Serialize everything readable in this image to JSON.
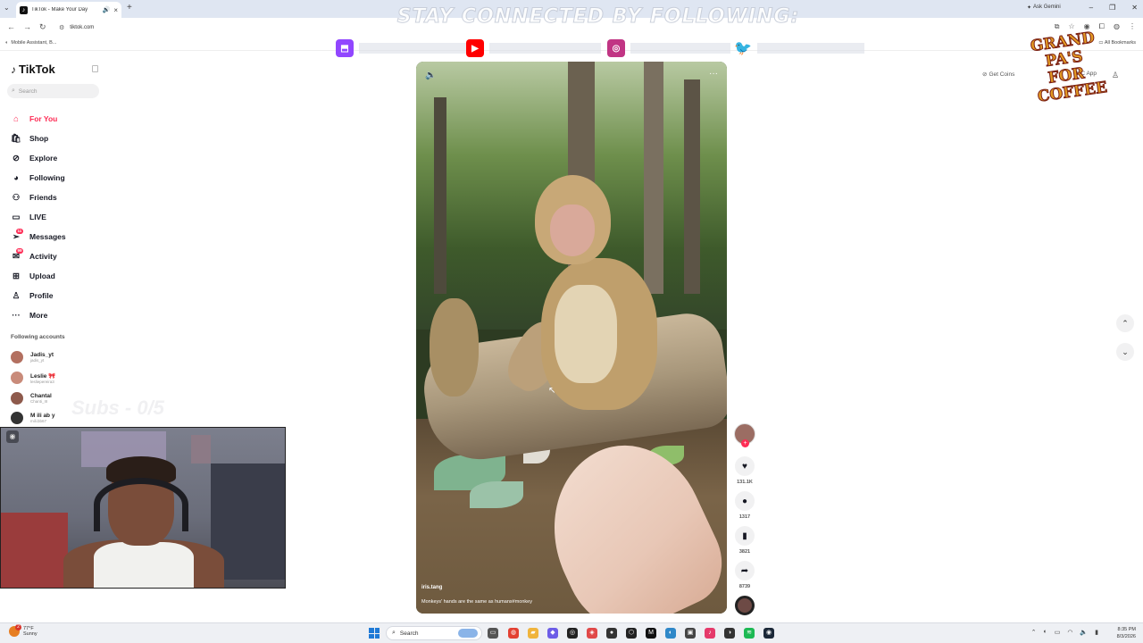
{
  "browser": {
    "tab_title": "TikTok - Make Your Day",
    "url": "tiktok.com",
    "bookmark_item": "Mobile Assistant, B...",
    "all_bookmarks": "All Bookmarks",
    "ask_gemini": "Ask Gemini"
  },
  "overlay": {
    "banner": "STAY CONNECTED BY FOLLOWING:",
    "logo_text": "GRANDPA'S FOR COFFEEE",
    "subs_ghost": "Subs - 0/5",
    "brand_colors": {
      "twitch": "#9146ff",
      "youtube": "#ff0000",
      "instagram": "#c13584",
      "twitter": "#1da1f2"
    }
  },
  "tiktok": {
    "logo": "TikTok",
    "search_placeholder": "Search",
    "accent_color": "#fe2c55",
    "nav": [
      {
        "label": "For You",
        "icon": "home-icon"
      },
      {
        "label": "Shop",
        "icon": "shop-icon"
      },
      {
        "label": "Explore",
        "icon": "compass-icon"
      },
      {
        "label": "Following",
        "icon": "following-icon"
      },
      {
        "label": "Friends",
        "icon": "friends-icon"
      },
      {
        "label": "LIVE",
        "icon": "live-icon"
      },
      {
        "label": "Messages",
        "icon": "messages-icon",
        "badge": "11"
      },
      {
        "label": "Activity",
        "icon": "activity-icon",
        "badge": "99"
      },
      {
        "label": "Upload",
        "icon": "upload-icon"
      },
      {
        "label": "Profile",
        "icon": "profile-icon"
      },
      {
        "label": "More",
        "icon": "more-icon"
      }
    ],
    "following_title": "Following accounts",
    "following": [
      {
        "name": "Jadis_yt",
        "handle": "jadis_yt"
      },
      {
        "name": "Leslie 🎀",
        "handle": "lesliepereira3"
      },
      {
        "name": "Chantal",
        "handle": "Chanti_III"
      },
      {
        "name": "M ili ab y",
        "handle": "mili.bb67"
      }
    ],
    "header": {
      "get_coins": "Get Coins",
      "pc_app": "PC App"
    },
    "video": {
      "author": "iris.tang",
      "caption": "Monkeys' hands are the same as humans#monkey"
    },
    "actions": {
      "likes": "131.1K",
      "comments": "1317",
      "saves": "3821",
      "shares": "8739"
    }
  },
  "taskbar": {
    "weather_temp": "77°F",
    "weather_desc": "Sunny",
    "weather_badge": "2",
    "search": "Search",
    "time": "8:35 PM",
    "date": "8/3/2026"
  }
}
